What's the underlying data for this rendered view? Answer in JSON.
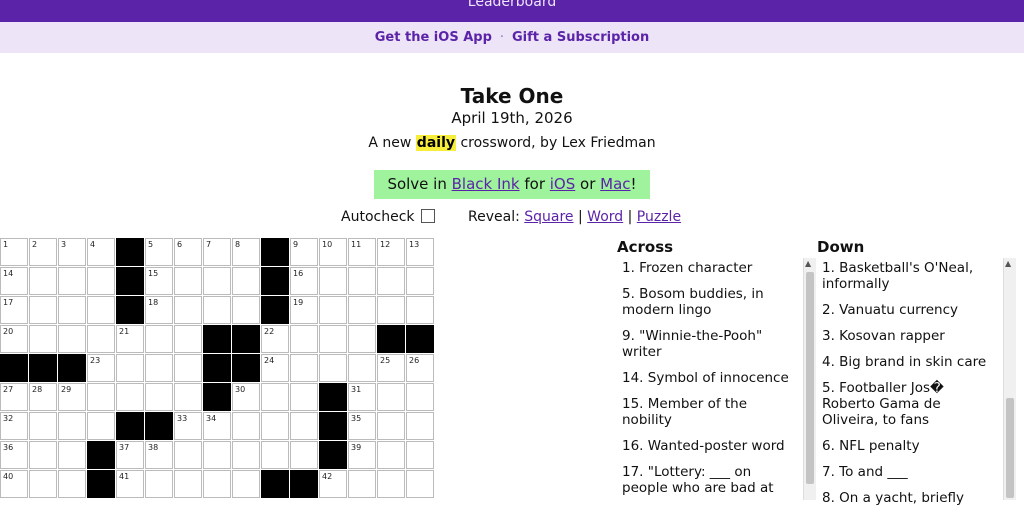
{
  "topbar": {
    "leaderboard": "Leaderboard"
  },
  "promo": {
    "ios_app": "Get the iOS App",
    "separator": "·",
    "gift": "Gift a Subscription"
  },
  "puzzle": {
    "title": "Take One",
    "date": "April 19th, 2026",
    "byline_prefix": "A new ",
    "byline_highlight": "daily",
    "byline_suffix": " crossword, by Lex Friedman"
  },
  "solve": {
    "prefix": "Solve in ",
    "black_ink": "Black Ink",
    "for": " for ",
    "ios": "iOS",
    "or": " or ",
    "mac": "Mac",
    "bang": "!"
  },
  "controls": {
    "autocheck": "Autocheck",
    "reveal_label": "Reveal:",
    "square": "Square",
    "word": "Word",
    "puzzle": "Puzzle",
    "sep": "|"
  },
  "grid": {
    "rows": [
      [
        "1",
        "2",
        "3",
        "4",
        "#",
        "5",
        "6",
        "7",
        "8",
        "#",
        "9",
        "10",
        "11",
        "12",
        "13"
      ],
      [
        "14",
        "",
        "",
        "",
        "#",
        "15",
        "",
        "",
        "",
        "#",
        "16",
        "",
        "",
        "",
        ""
      ],
      [
        "17",
        "",
        "",
        "",
        "#",
        "18",
        "",
        "",
        "",
        "#",
        "19",
        "",
        "",
        "",
        ""
      ],
      [
        "20",
        "",
        "",
        "",
        "21",
        "",
        "",
        "#",
        "#",
        "22",
        "",
        "",
        "",
        "#",
        "#"
      ],
      [
        "#",
        "#",
        "#",
        "23",
        "",
        "",
        "",
        "#",
        "#",
        "24",
        "",
        "",
        "",
        "25",
        "26"
      ],
      [
        "27",
        "28",
        "29",
        "",
        "",
        "",
        "",
        "#",
        "30",
        "",
        "",
        "#",
        "31",
        "",
        ""
      ],
      [
        "32",
        "",
        "",
        "",
        "#",
        "#",
        "33",
        "34",
        "",
        "",
        "",
        "#",
        "35",
        "",
        ""
      ],
      [
        "36",
        "",
        "",
        "#",
        "37",
        "38",
        "",
        "",
        "",
        "",
        "",
        "#",
        "39",
        "",
        ""
      ],
      [
        "40",
        "",
        "",
        "#",
        "41",
        "",
        "",
        "",
        "",
        "#",
        "#",
        "42",
        "",
        "",
        ""
      ]
    ]
  },
  "across": {
    "heading": "Across",
    "clues": [
      "1. Frozen character",
      "5. Bosom buddies, in modern lingo",
      "9. \"Winnie-the-Pooh\" writer",
      "14. Symbol of innocence",
      "15. Member of the nobility",
      "16. Wanted-poster word",
      "17. \"Lottery: ___ on people who are bad at"
    ]
  },
  "down": {
    "heading": "Down",
    "clues": [
      "1. Basketball's O'Neal, informally",
      "2. Vanuatu currency",
      "3. Kosovan rapper",
      "4. Big brand in skin care",
      "5. Footballer Jos� Roberto Gama de Oliveira, to fans",
      "6. NFL penalty",
      "7. To and ___",
      "8. On a yacht, briefly"
    ]
  },
  "icons": {
    "scroll_up": "▲"
  }
}
